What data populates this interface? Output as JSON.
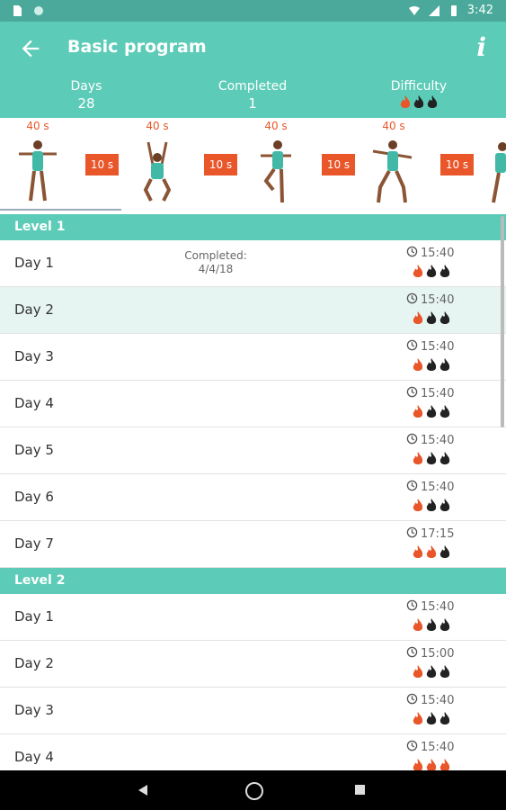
{
  "status_bar": {
    "time": "3:42"
  },
  "app_bar": {
    "title": "Basic program",
    "info_label": "i"
  },
  "stats": {
    "days_label": "Days",
    "days_value": "28",
    "completed_label": "Completed",
    "completed_value": "1",
    "difficulty_label": "Difficulty",
    "difficulty_level": 1
  },
  "exercise_strip": {
    "exercises": [
      {
        "duration": "40 s"
      },
      {
        "duration": "40 s"
      },
      {
        "duration": "40 s"
      },
      {
        "duration": "40 s"
      }
    ],
    "rests": [
      "10 s",
      "10 s",
      "10 s",
      "10 s"
    ]
  },
  "levels": [
    {
      "title": "Level 1",
      "days": [
        {
          "label": "Day 1",
          "completed_label": "Completed:",
          "completed_date": "4/4/18",
          "time": "15:40",
          "flames": 1
        },
        {
          "label": "Day 2",
          "time": "15:40",
          "flames": 1
        },
        {
          "label": "Day 3",
          "time": "15:40",
          "flames": 1
        },
        {
          "label": "Day 4",
          "time": "15:40",
          "flames": 1
        },
        {
          "label": "Day 5",
          "time": "15:40",
          "flames": 1
        },
        {
          "label": "Day 6",
          "time": "15:40",
          "flames": 1
        },
        {
          "label": "Day 7",
          "time": "17:15",
          "flames": 2
        }
      ]
    },
    {
      "title": "Level 2",
      "days": [
        {
          "label": "Day 1",
          "time": "15:40",
          "flames": 1
        },
        {
          "label": "Day 2",
          "time": "15:00",
          "flames": 1
        },
        {
          "label": "Day 3",
          "time": "15:40",
          "flames": 1
        },
        {
          "label": "Day 4",
          "time": "15:40",
          "flames": 3
        }
      ]
    }
  ],
  "colors": {
    "accent": "#5ccbb7",
    "status_bar": "#4aa99a",
    "flame_active": "#e8562a",
    "flame_inactive": "#222222",
    "highlight_row": "#e6f5f2"
  }
}
